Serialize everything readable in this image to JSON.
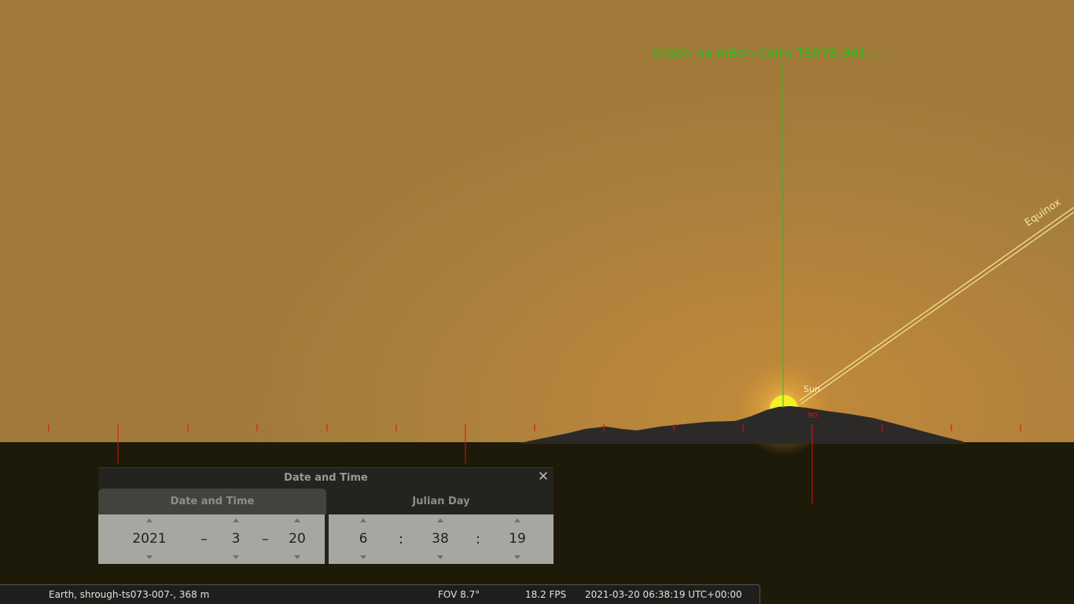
{
  "colors": {
    "sky": "#a87f3c",
    "ground": "#1d1a09",
    "target_line": "#22c41a",
    "cardinal_marks": "#e01010",
    "equinox_line": "#f5ea9a",
    "sun": "#f4f025"
  },
  "sky": {
    "target_label": "Sliabh na mBan Cairn TS078-001----",
    "sun_label": "Sun",
    "azimuth_label": "90",
    "equinox_label": "Equinox"
  },
  "dialog": {
    "title": "Date and Time",
    "close_icon": "close-icon",
    "tabs": [
      {
        "label": "Date and Time",
        "active": true
      },
      {
        "label": "Julian Day",
        "active": false
      }
    ],
    "date": {
      "year": "2021",
      "month": "3",
      "day": "20",
      "sep": "–"
    },
    "time": {
      "hour": "6",
      "minute": "38",
      "second": "19",
      "sep": ":"
    }
  },
  "statusbar": {
    "location": "Earth, shrough-ts073-007-, 368 m",
    "fov": "FOV 8.7°",
    "fps": "18.2 FPS",
    "datetime": "2021-03-20 06:38:19 UTC+00:00"
  }
}
